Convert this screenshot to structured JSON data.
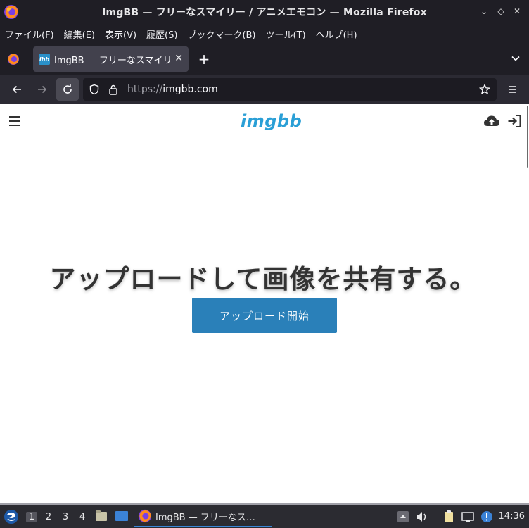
{
  "window": {
    "title": "ImgBB — フリーなスマイリー / アニメエモコン — Mozilla Firefox",
    "controls": {
      "minimize": "⌄",
      "restore": "◇",
      "close": "✕"
    }
  },
  "menubar": {
    "items": [
      "ファイル(F)",
      "編集(E)",
      "表示(V)",
      "履歴(S)",
      "ブックマーク(B)",
      "ツール(T)",
      "ヘルプ(H)"
    ]
  },
  "tabs": {
    "active_title": "ImgBB — フリーなスマイリー",
    "favicon_text": "ibb",
    "close_glyph": "✕",
    "new_tab_glyph": "+"
  },
  "navbar": {
    "url_scheme": "https://",
    "url_host": "imgbb.com"
  },
  "page": {
    "logo": "imgbb",
    "hero_title": "アップロードして画像を共有する。",
    "upload_button": "アップロード開始"
  },
  "taskbar": {
    "workspaces": [
      "1",
      "2",
      "3",
      "4"
    ],
    "active_workspace": "1",
    "task_label": "ImgBB — フリーなス…",
    "clock": "14:36"
  },
  "colors": {
    "accent": "#2a80b9",
    "logo": "#2a9fd6",
    "toolbar": "#2b2a33",
    "titlebar": "#1f1e25"
  }
}
